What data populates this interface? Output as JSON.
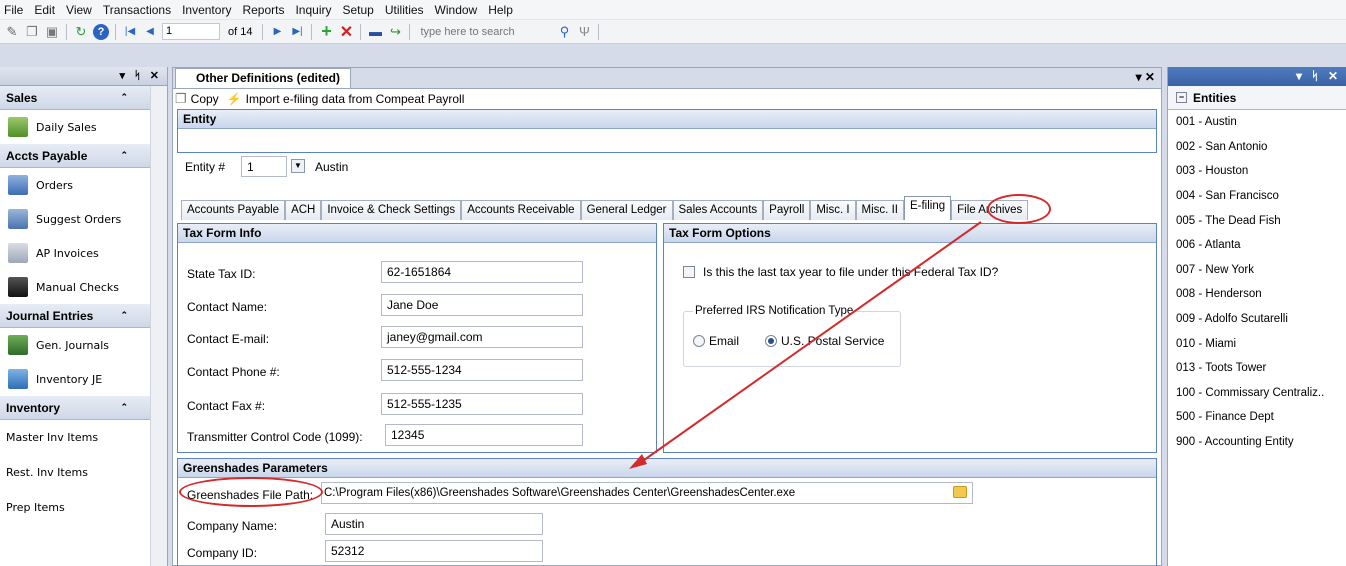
{
  "menu": [
    "File",
    "Edit",
    "View",
    "Transactions",
    "Inventory",
    "Reports",
    "Inquiry",
    "Setup",
    "Utilities",
    "Window",
    "Help"
  ],
  "toolbar": {
    "page": "1",
    "of": "of 14",
    "search_placeholder": "type here to search"
  },
  "left_panel": {
    "head_icons": "▾ ᛋ ✕",
    "sections": [
      {
        "title": "Sales",
        "items": [
          "Daily Sales"
        ]
      },
      {
        "title": "Accts Payable",
        "items": [
          "Orders",
          "Suggest Orders",
          "AP Invoices",
          "Manual Checks"
        ]
      },
      {
        "title": "Journal Entries",
        "items": [
          "Gen. Journals",
          "Inventory JE"
        ]
      },
      {
        "title": "Inventory",
        "items": [
          "Master Inv Items",
          "Rest. Inv Items",
          "Prep Items"
        ]
      }
    ]
  },
  "document": {
    "tab": "Other Definitions (edited)",
    "actions": {
      "copy": "Copy",
      "import": "Import e-filing data from Compeat Payroll"
    },
    "entity": {
      "title": "Entity",
      "label": "Entity #",
      "number": "1",
      "name": "Austin"
    },
    "tabs": [
      "Accounts Payable",
      "ACH",
      "Invoice & Check Settings",
      "Accounts Receivable",
      "General Ledger",
      "Sales Accounts",
      "Payroll",
      "Misc. I",
      "Misc. II",
      "E-filing",
      "File Archives"
    ],
    "tax_form_info": {
      "title": "Tax Form Info",
      "fields": [
        {
          "label": "State Tax ID:",
          "value": "62-1651864"
        },
        {
          "label": "Contact Name:",
          "value": "Jane Doe"
        },
        {
          "label": "Contact E-mail:",
          "value": "janey@gmail.com"
        },
        {
          "label": "Contact Phone #:",
          "value": "512-555-1234"
        },
        {
          "label": "Contact Fax #:",
          "value": "512-555-1235"
        },
        {
          "label": "Transmitter Control Code (1099):",
          "value": "12345"
        }
      ]
    },
    "tax_form_options": {
      "title": "Tax Form Options",
      "checkbox": "Is this the last tax year to file under this Federal Tax ID?",
      "notification_label": "Preferred IRS Notification Type",
      "email": "Email",
      "postal": "U.S. Postal Service"
    },
    "greenshades": {
      "title": "Greenshades Parameters",
      "path_label": "Greenshades File Path:",
      "path": "C:\\Program Files(x86)\\Greenshades Software\\Greenshades Center\\GreenshadesCenter.exe",
      "company_name_label": "Company Name:",
      "company_name": "Austin",
      "company_id_label": "Company ID:",
      "company_id": "52312"
    }
  },
  "right_panel": {
    "title": "Entities",
    "items": [
      "001 - Austin",
      "002 - San Antonio",
      "003 - Houston",
      "004 - San Francisco",
      "005 - The Dead Fish",
      "006 - Atlanta",
      "007 - New York",
      "008 - Henderson",
      "009 - Adolfo Scutarelli",
      "010 - Miami",
      "013 - Toots Tower",
      "100 - Commissary Centraliz..",
      "500 - Finance Dept",
      "900 - Accounting Entity"
    ]
  },
  "colors": {
    "accent": "#3a62a6",
    "annotation": "#d42a2a"
  }
}
